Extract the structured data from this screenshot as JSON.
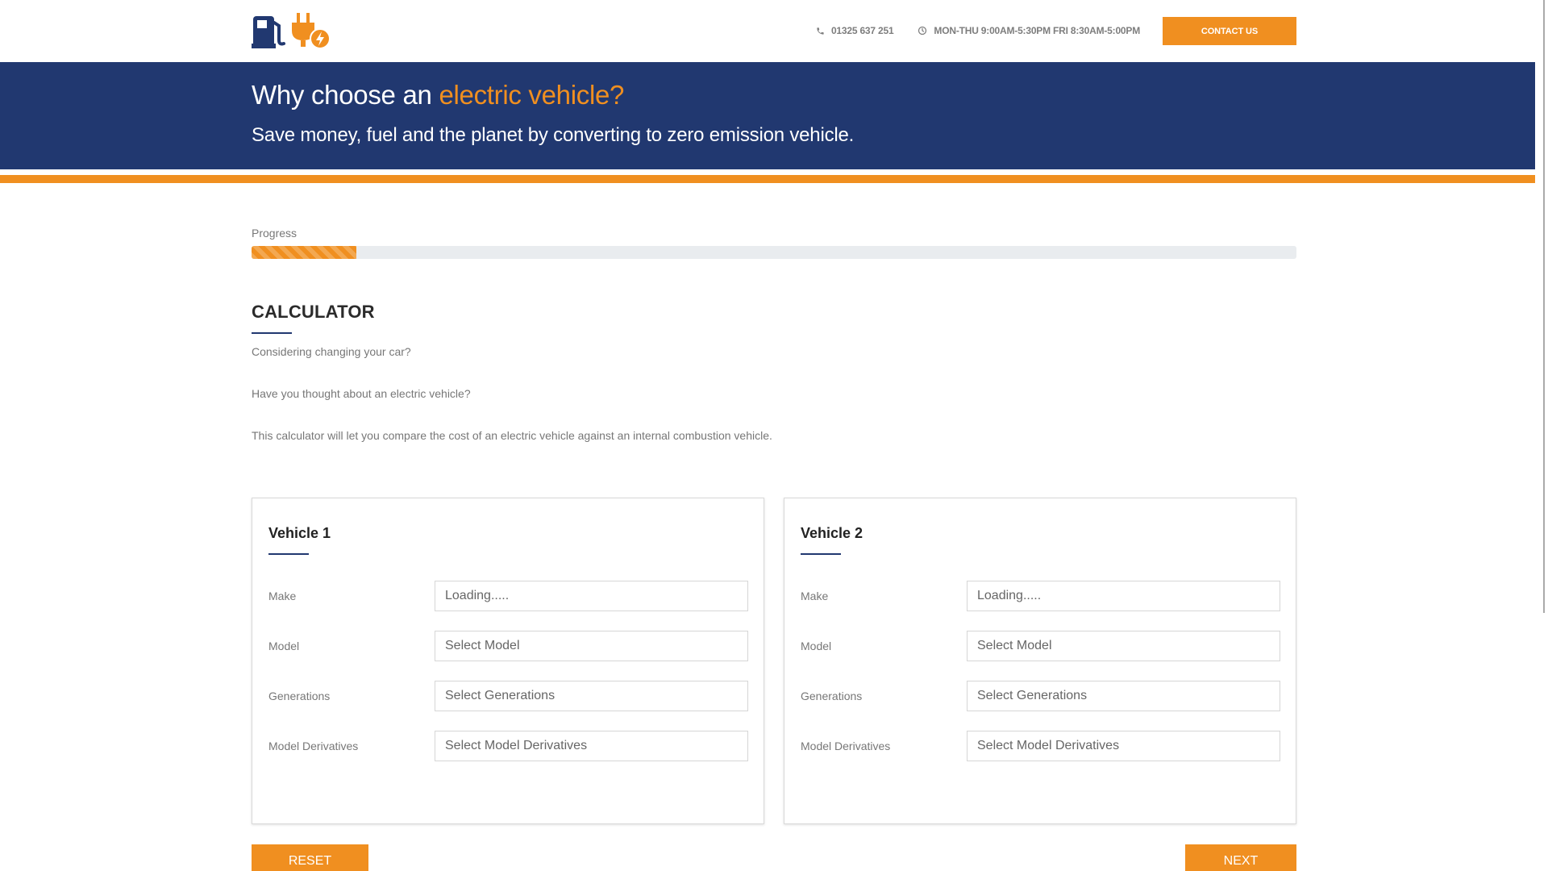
{
  "header": {
    "phone": "01325 637 251",
    "hours": "MON-THU 9:00AM-5:30PM FRI 8:30AM-5:00PM",
    "contact_button": "CONTACT US",
    "icons": [
      "fuel-pump-icon",
      "electric-plug-icon",
      "phone-icon",
      "clock-icon"
    ]
  },
  "hero": {
    "title_prefix": "Why choose an ",
    "title_accent": "electric vehicle?",
    "subtitle": "Save money, fuel and the planet by converting to zero emission vehicle."
  },
  "progress": {
    "label": "Progress",
    "percent": 10
  },
  "calculator": {
    "title": "CALCULATOR",
    "intro": [
      "Considering changing your car?",
      "Have you thought about an electric vehicle?",
      "This calculator will let you compare the cost of an electric vehicle against an internal combustion vehicle."
    ]
  },
  "vehicles": [
    {
      "title": "Vehicle 1",
      "fields": [
        {
          "label": "Make",
          "value": "Loading....."
        },
        {
          "label": "Model",
          "value": "Select Model"
        },
        {
          "label": "Generations",
          "value": "Select Generations"
        },
        {
          "label": "Model Derivatives",
          "value": "Select Model Derivatives"
        }
      ]
    },
    {
      "title": "Vehicle 2",
      "fields": [
        {
          "label": "Make",
          "value": "Loading....."
        },
        {
          "label": "Model",
          "value": "Select Model"
        },
        {
          "label": "Generations",
          "value": "Select Generations"
        },
        {
          "label": "Model Derivatives",
          "value": "Select Model Derivatives"
        }
      ]
    }
  ],
  "buttons": {
    "reset": "RESET",
    "next": "NEXT"
  },
  "colors": {
    "brand_blue": "#213870",
    "accent_orange": "#f08f20"
  }
}
